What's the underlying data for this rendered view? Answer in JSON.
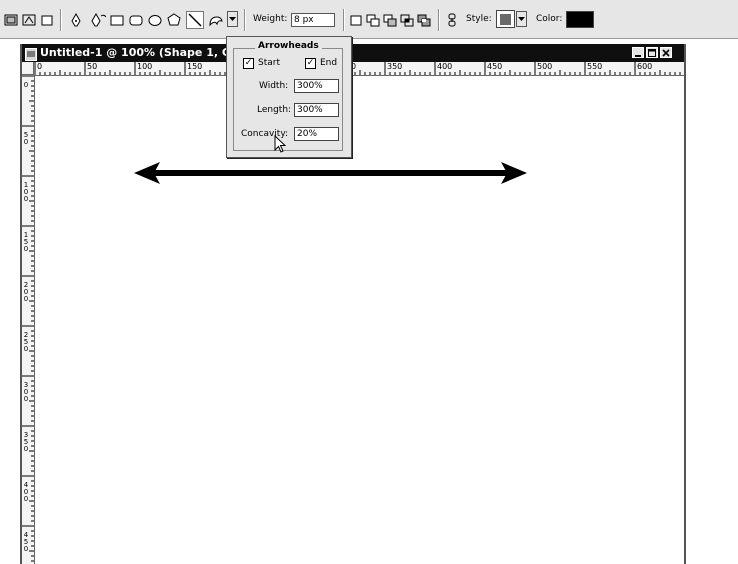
{
  "toolbar": {
    "weight_label": "Weight:",
    "weight_value": "8 px",
    "style_label": "Style:",
    "color_label": "Color:",
    "style_swatch": "#6a6a6a",
    "color_swatch": "#000000"
  },
  "document": {
    "title": "Untitled-1 @ 100% (Shape 1, Gr",
    "ruler_h": [
      "0",
      "50",
      "100",
      "150",
      "0",
      "350",
      "400",
      "450",
      "500",
      "550",
      "600"
    ],
    "ruler_v": [
      "0",
      "5\n0",
      "1\n0\n0",
      "1\n5\n0",
      "2\n0\n0",
      "2\n5\n0",
      "3\n0\n0",
      "3\n5\n0",
      "4\n0\n0",
      "4\n5\n0"
    ]
  },
  "arrowheads": {
    "title": "Arrowheads",
    "start_label": "Start",
    "start_checked": true,
    "end_label": "End",
    "end_checked": true,
    "width_label": "Width:",
    "width_value": "300%",
    "length_label": "Length:",
    "length_value": "300%",
    "concavity_label": "Concavity:",
    "concavity_value": "20%"
  }
}
